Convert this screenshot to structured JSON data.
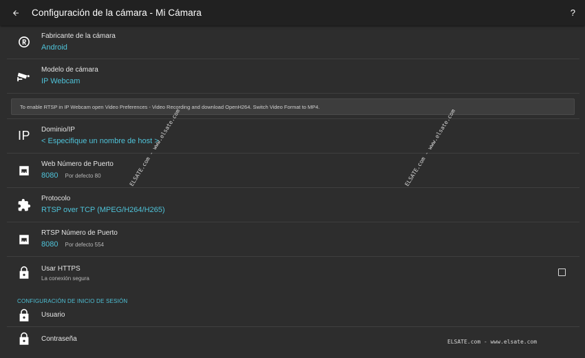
{
  "appbar": {
    "title": "Configuración de la cámara - Mi Cámara",
    "help_label": "?"
  },
  "rows": {
    "manufacturer": {
      "label": "Fabricante de la cámara",
      "value": "Android",
      "icon": "registered-icon"
    },
    "model": {
      "label": "Modelo de cámara",
      "value": "IP Webcam",
      "icon": "cctv-camera-icon"
    },
    "domain": {
      "label": "Dominio/IP",
      "value": "< Especifique un nombre de host >",
      "icon_text": "IP"
    },
    "web_port": {
      "label": "Web Número de Puerto",
      "value": "8080",
      "hint": "Por defecto 80",
      "icon": "ethernet-port-icon"
    },
    "protocol": {
      "label": "Protocolo",
      "value": "RTSP over TCP (MPEG/H264/H265)",
      "icon": "puzzle-icon"
    },
    "rtsp_port": {
      "label": "RTSP Número de Puerto",
      "value": "8080",
      "hint": "Por defecto 554",
      "icon": "ethernet-port-icon"
    },
    "https": {
      "label": "Usar HTTPS",
      "sub": "La conexión segura",
      "checked": false,
      "icon": "lock-icon"
    },
    "user": {
      "label": "Usuario",
      "icon": "lock-icon"
    },
    "password": {
      "label": "Contraseña",
      "icon": "lock-icon"
    }
  },
  "notice": "To enable RTSP in IP Webcam open Video Preferences - Video Recording and download OpenH264. Switch Video Format to MP4.",
  "section_login": "CONFIGURACIÓN DE INICIO DE SESIÓN",
  "watermarks": {
    "diag1": "ELSATE.com - www.elsate.com",
    "diag2": "ELSATE.com - www.elsate.com",
    "bottom": "ELSATE.com - www.elsate.com"
  },
  "colors": {
    "accent": "#4fc3d9",
    "background": "#2d2d2d",
    "appbar": "#212121"
  }
}
